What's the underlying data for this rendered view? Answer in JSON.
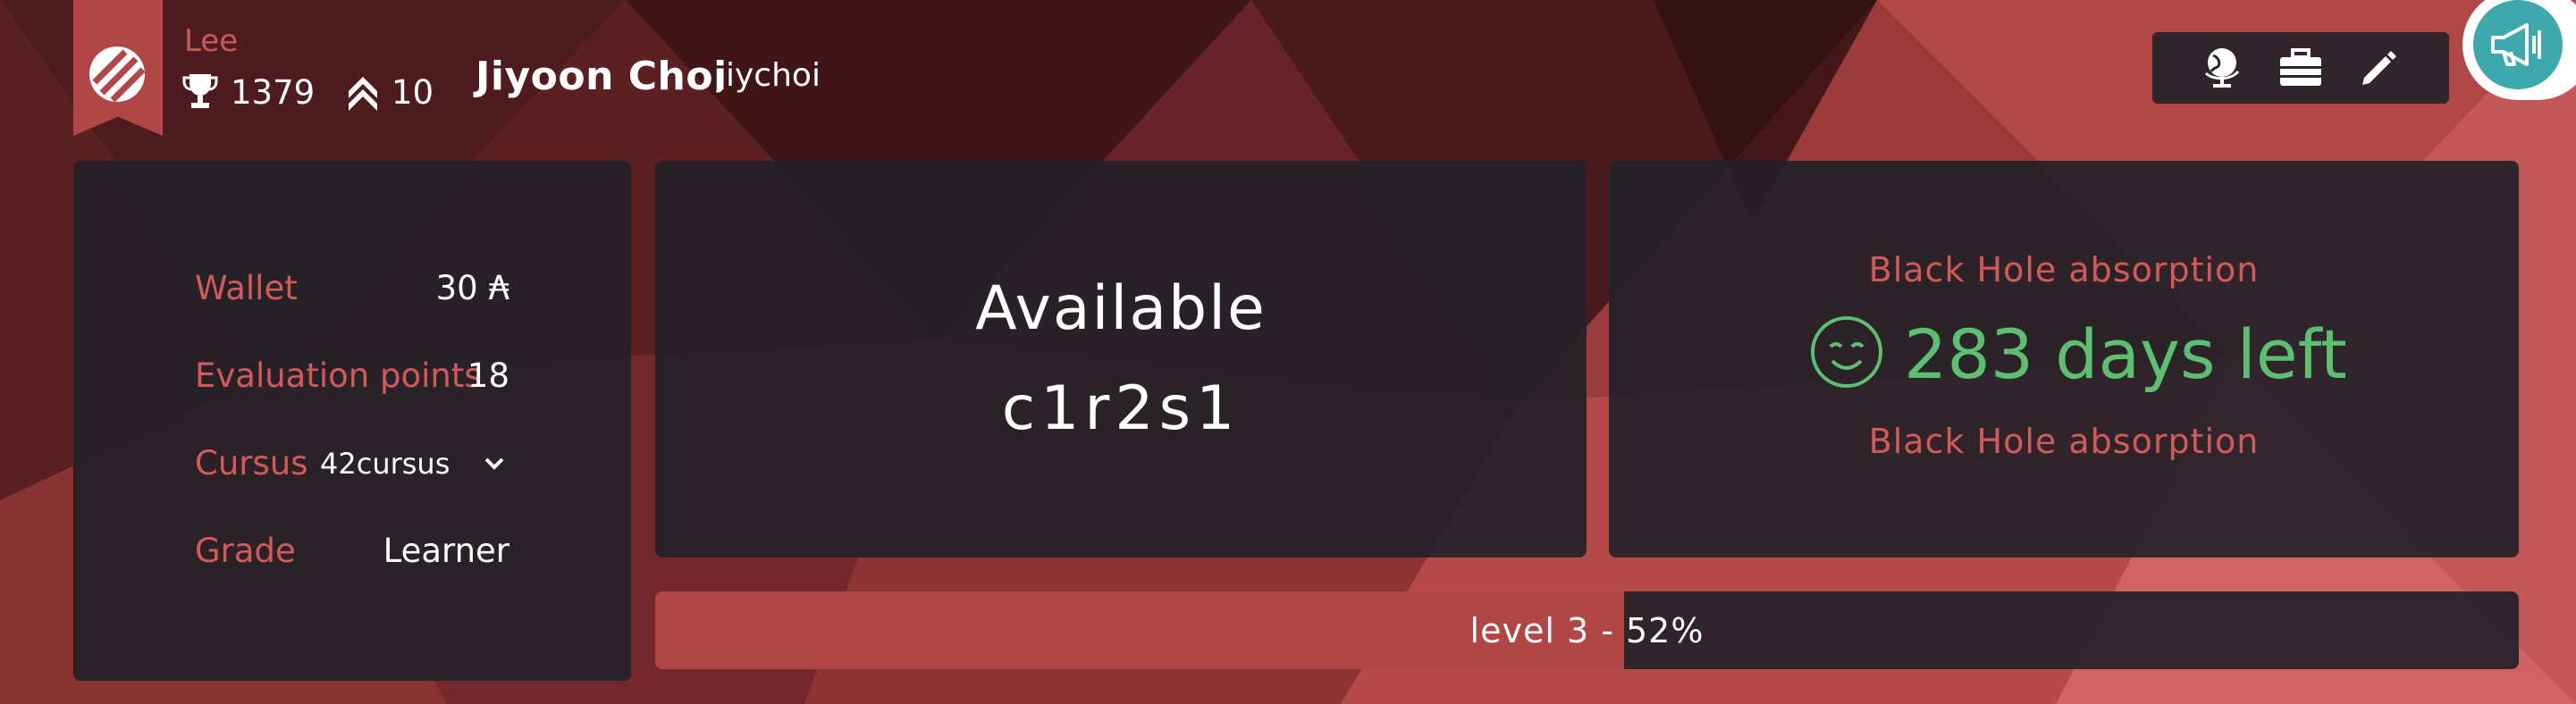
{
  "coalition": {
    "name": "Lee",
    "color": "#b14646"
  },
  "user": {
    "display_name": "Jiyoon Choi",
    "login": "jiychoi",
    "points": "1379",
    "level_rank": "10"
  },
  "toolbar": {
    "icons": [
      "globe-icon",
      "briefcase-icon",
      "pencil-icon"
    ]
  },
  "announcement": {
    "icon": "megaphone-icon",
    "color": "#3ea9ad"
  },
  "profile_stats": [
    {
      "label": "Wallet",
      "value": "30 ₳"
    },
    {
      "label": "Evaluation points",
      "value": "18"
    },
    {
      "label": "Cursus",
      "value": "42cursus"
    },
    {
      "label": "Grade",
      "value": "Learner"
    }
  ],
  "location": {
    "status": "Available",
    "host": "c1r2s1"
  },
  "black_hole": {
    "title": "Black Hole absorption",
    "days_left": "283 days left",
    "subtitle": "Black Hole absorption",
    "color": "#5cbf72"
  },
  "level": {
    "text": "level 3 - 52%",
    "progress": 0.52
  }
}
